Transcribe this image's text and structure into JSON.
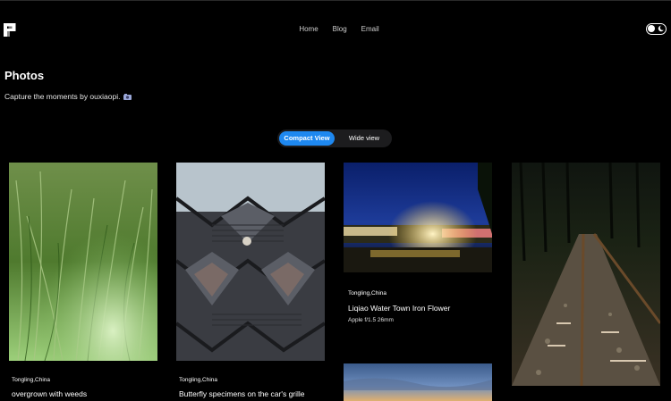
{
  "header": {
    "logo_icon": "p-logo-icon",
    "nav": [
      {
        "label": "Home"
      },
      {
        "label": "Blog"
      },
      {
        "label": "Email"
      }
    ],
    "theme_toggle_icon": "theme-toggle-icon"
  },
  "page": {
    "title": "Photos",
    "subtitle": "Capture the moments by ouxiaopi."
  },
  "view_switch": {
    "compact": "Compact View",
    "wide": "Wide view",
    "active": "compact"
  },
  "colors": {
    "accent": "#1e88f0",
    "background": "#000000"
  },
  "photos": [
    {
      "location": "Tongling,China",
      "name": "overgrown with weeds",
      "exif": ""
    },
    {
      "location": "Tongling,China",
      "name": "Butterfly specimens on the car's grille",
      "exif": ""
    },
    {
      "location": "Tongling,China",
      "name": "Liqiao Water Town Iron Flower",
      "exif": "Apple f/1.5 26mm"
    },
    {
      "location": "",
      "name": "",
      "exif": ""
    },
    {
      "location": "",
      "name": "",
      "exif": ""
    }
  ]
}
